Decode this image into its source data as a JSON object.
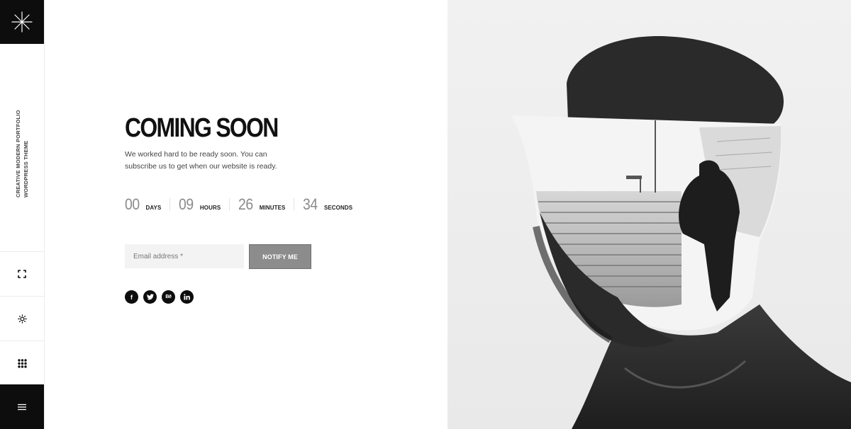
{
  "sidebar": {
    "tagline_line1": "CREATIVE MODERN PORTFOLIO",
    "tagline_line2": "WORDPRESS THEME"
  },
  "hero": {
    "title": "COMING SOON",
    "subtitle": "We worked hard to be ready soon. You can subscribe us to get when our website is ready."
  },
  "countdown": [
    {
      "value": "00",
      "label": "DAYS"
    },
    {
      "value": "09",
      "label": "HOURS"
    },
    {
      "value": "26",
      "label": "MINUTES"
    },
    {
      "value": "34",
      "label": "SECONDS"
    }
  ],
  "subscribe": {
    "placeholder": "Email address *",
    "button_label": "NOTIFY ME"
  },
  "social": {
    "facebook": "f",
    "behance": "Bē"
  }
}
